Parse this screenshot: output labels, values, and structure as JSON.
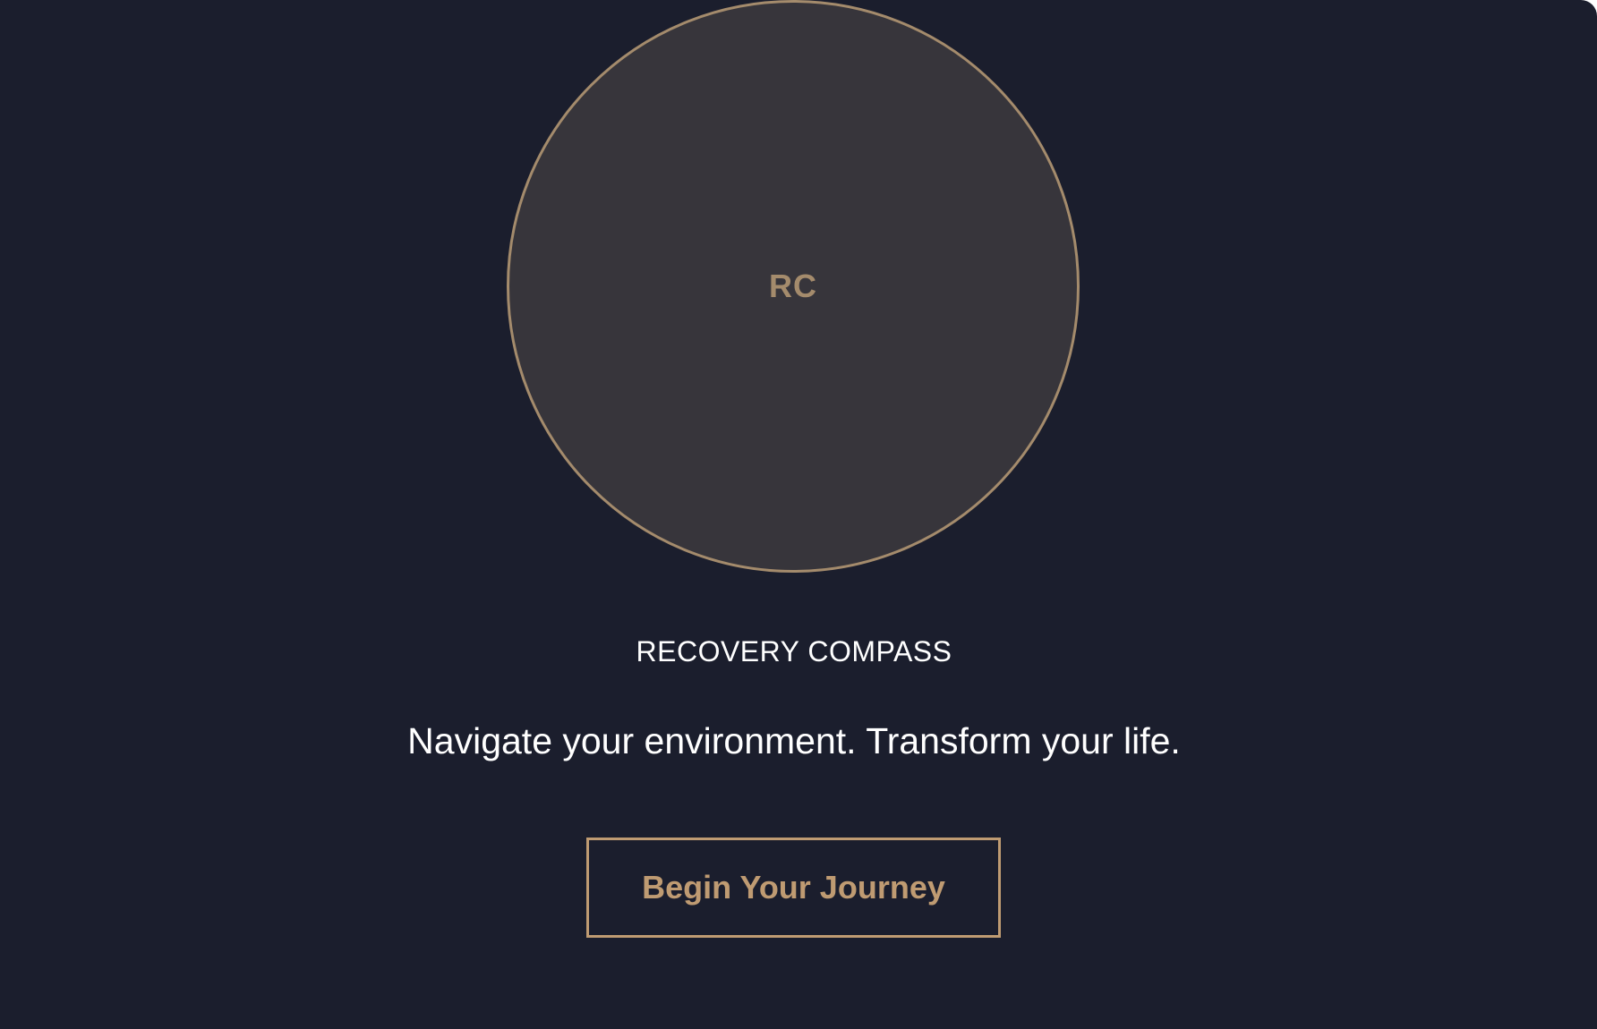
{
  "logo": {
    "initials": "RC"
  },
  "brand": {
    "name": "RECOVERY COMPASS"
  },
  "hero": {
    "tagline": "Navigate your environment. Transform your life."
  },
  "cta": {
    "label": "Begin Your Journey"
  },
  "colors": {
    "background": "#1b1e2d",
    "circle_fill": "#37353b",
    "accent_gold": "#a48b6c",
    "button_gold": "#bf9b72",
    "text_white": "#ffffff"
  }
}
